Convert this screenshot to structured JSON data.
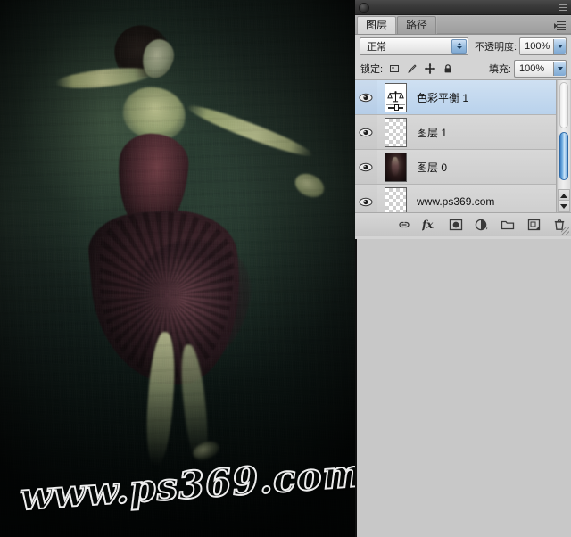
{
  "document": {
    "photo_alt": "dark green toned photograph of a dancing woman in a dark dress",
    "watermark_text": "www.ps369.com"
  },
  "panel": {
    "titlebar": {
      "dot_icon": "circle-icon",
      "collapse_icon": "collapse-panel-icon"
    },
    "tabs": [
      {
        "label": "图层",
        "active": true
      },
      {
        "label": "路径",
        "active": false
      }
    ],
    "menu_icon": "panel-menu-icon",
    "blend_mode": {
      "value": "正常",
      "stepper_icon": "stepper-arrows-icon"
    },
    "opacity": {
      "label": "不透明度:",
      "value": "100%",
      "arrow_icon": "chevron-down-icon"
    },
    "lock": {
      "label": "锁定:",
      "icons": [
        {
          "name": "lock-transparent-pixels-icon"
        },
        {
          "name": "lock-image-pixels-icon"
        },
        {
          "name": "lock-position-icon"
        },
        {
          "name": "lock-all-icon"
        }
      ]
    },
    "fill": {
      "label": "填充:",
      "value": "100%",
      "arrow_icon": "chevron-down-icon"
    },
    "layers": [
      {
        "name": "色彩平衡 1",
        "visible": true,
        "selected": true,
        "thumb_type": "adjustment",
        "thumb_icon": "color-balance-icon"
      },
      {
        "name": "图层 1",
        "visible": true,
        "selected": false,
        "thumb_type": "transparent",
        "thumb_icon": "checkerboard-thumb"
      },
      {
        "name": "图层 0",
        "visible": true,
        "selected": false,
        "thumb_type": "photo",
        "thumb_icon": "photo-thumb"
      },
      {
        "name": "www.ps369.com",
        "visible": true,
        "selected": false,
        "thumb_type": "transparent",
        "thumb_icon": "checkerboard-thumb"
      }
    ],
    "scrollbar": {
      "up_arrow_icon": "scroll-up-icon",
      "down_arrow_icon": "scroll-down-icon"
    },
    "footer_buttons": [
      {
        "name": "link-layers-icon"
      },
      {
        "name": "layer-style-fx-icon"
      },
      {
        "name": "add-layer-mask-icon"
      },
      {
        "name": "new-adjustment-layer-icon"
      },
      {
        "name": "new-group-icon"
      },
      {
        "name": "new-layer-icon"
      },
      {
        "name": "delete-layer-icon"
      }
    ]
  },
  "colors": {
    "selection_blue": "#b9d2ec",
    "panel_gray": "#d4d4d4",
    "titlebar_dark": "#3a3a3a",
    "scrollbar_blue": "#3e7fc4",
    "photo_green": "#2a3a31"
  }
}
